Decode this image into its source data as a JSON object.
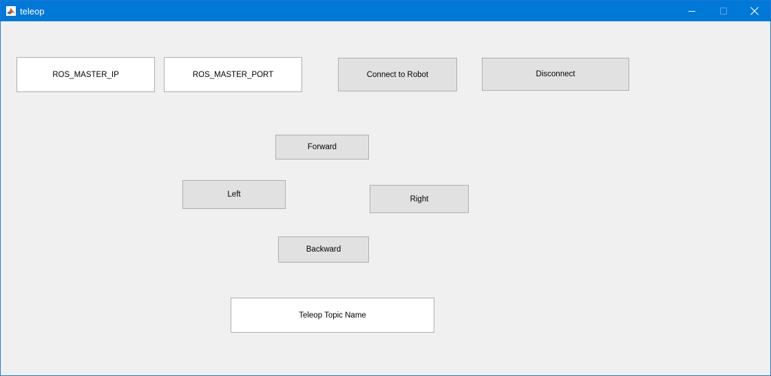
{
  "window": {
    "title": "teleop",
    "icon": "matlab-logo-icon",
    "controls": {
      "minimize_icon": "minimize-icon",
      "maximize_icon": "maximize-icon",
      "close_icon": "close-icon"
    }
  },
  "connection": {
    "ip_field_value": "ROS_MASTER_IP",
    "port_field_value": "ROS_MASTER_PORT",
    "connect_label": "Connect to Robot",
    "disconnect_label": "Disconnect"
  },
  "drive": {
    "forward_label": "Forward",
    "left_label": "Left",
    "right_label": "Right",
    "backward_label": "Backward"
  },
  "topic": {
    "field_value": "Teleop Topic Name"
  },
  "colors": {
    "titlebar": "#0078d7",
    "background": "#f0f0f0",
    "button_face": "#e1e1e1",
    "field_face": "#ffffff",
    "border": "#adadad"
  }
}
